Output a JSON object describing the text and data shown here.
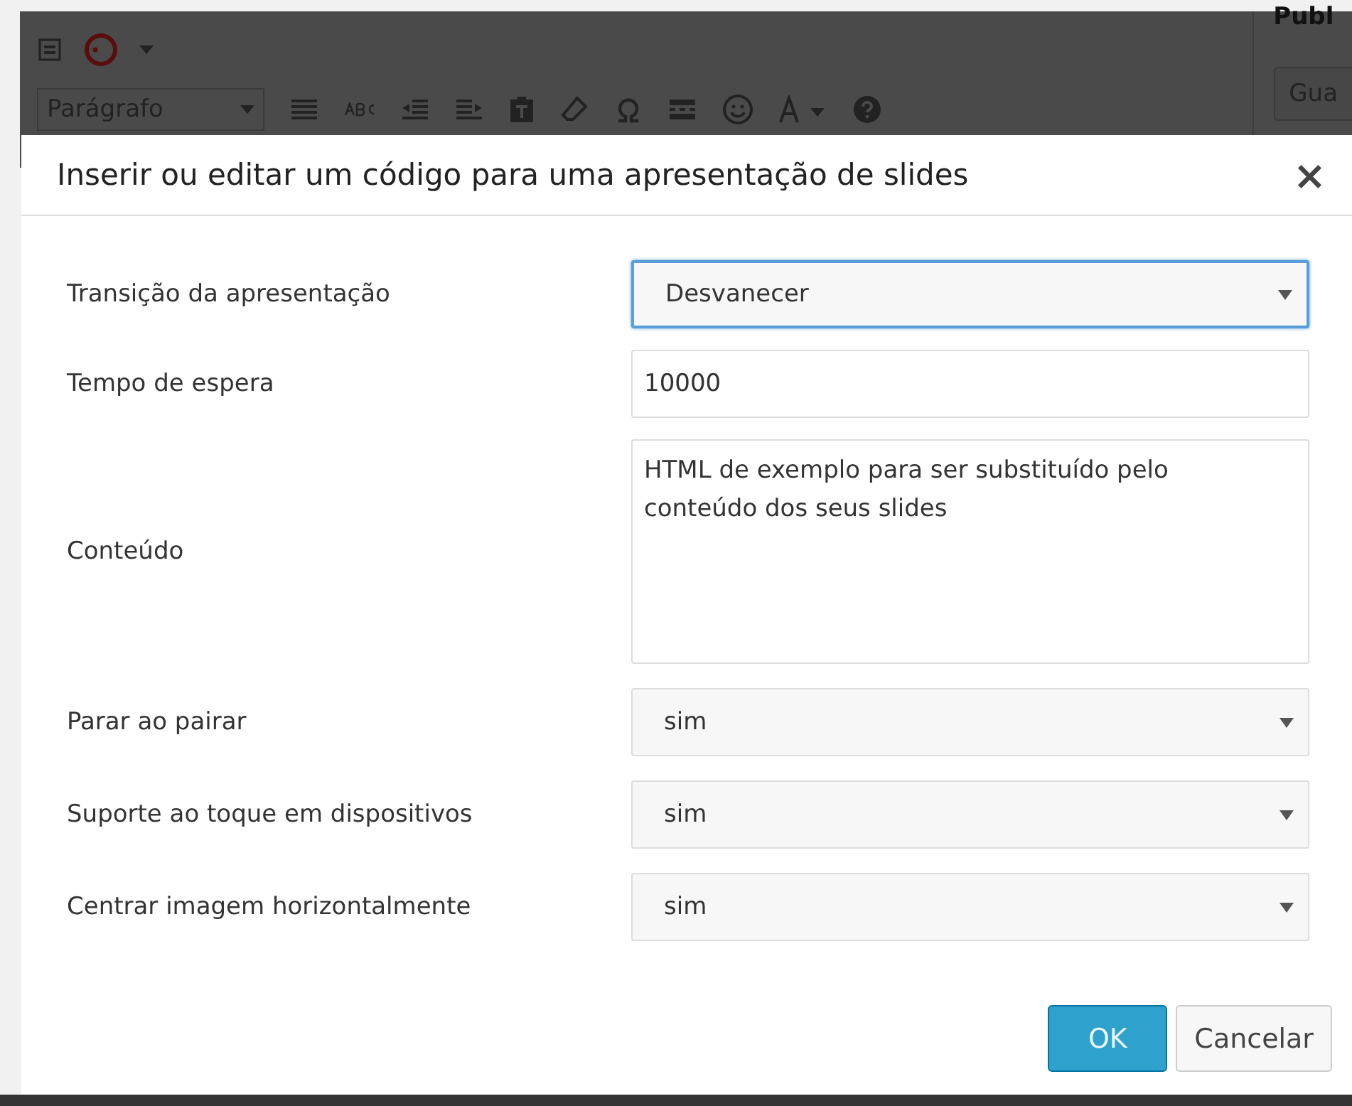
{
  "editor": {
    "format_select": "Parágrafo",
    "side_heading": "Publ",
    "side_button": "Gua"
  },
  "dialog": {
    "title": "Inserir ou editar um código para uma apresentação de slides",
    "close": "×",
    "fields": [
      {
        "label": "Transição da apresentação",
        "kind": "select",
        "value": "Desvanecer",
        "focused": true
      },
      {
        "label": "Tempo de espera",
        "kind": "text",
        "value": "10000",
        "focused": false
      },
      {
        "label": "Conteúdo",
        "kind": "textarea",
        "value": "HTML de exemplo para ser substituído pelo conteúdo dos seus slides",
        "focused": false
      },
      {
        "label": "Parar ao pairar",
        "kind": "select",
        "value": "sim",
        "focused": false
      },
      {
        "label": "Suporte ao toque em dispositivos",
        "kind": "select",
        "value": "sim",
        "focused": false
      },
      {
        "label": "Centrar imagem horizontalmente",
        "kind": "select",
        "value": "sim",
        "focused": false
      }
    ],
    "buttons": [
      {
        "label": "OK",
        "kind": "primary"
      },
      {
        "label": "Cancelar",
        "kind": "secondary"
      }
    ]
  }
}
